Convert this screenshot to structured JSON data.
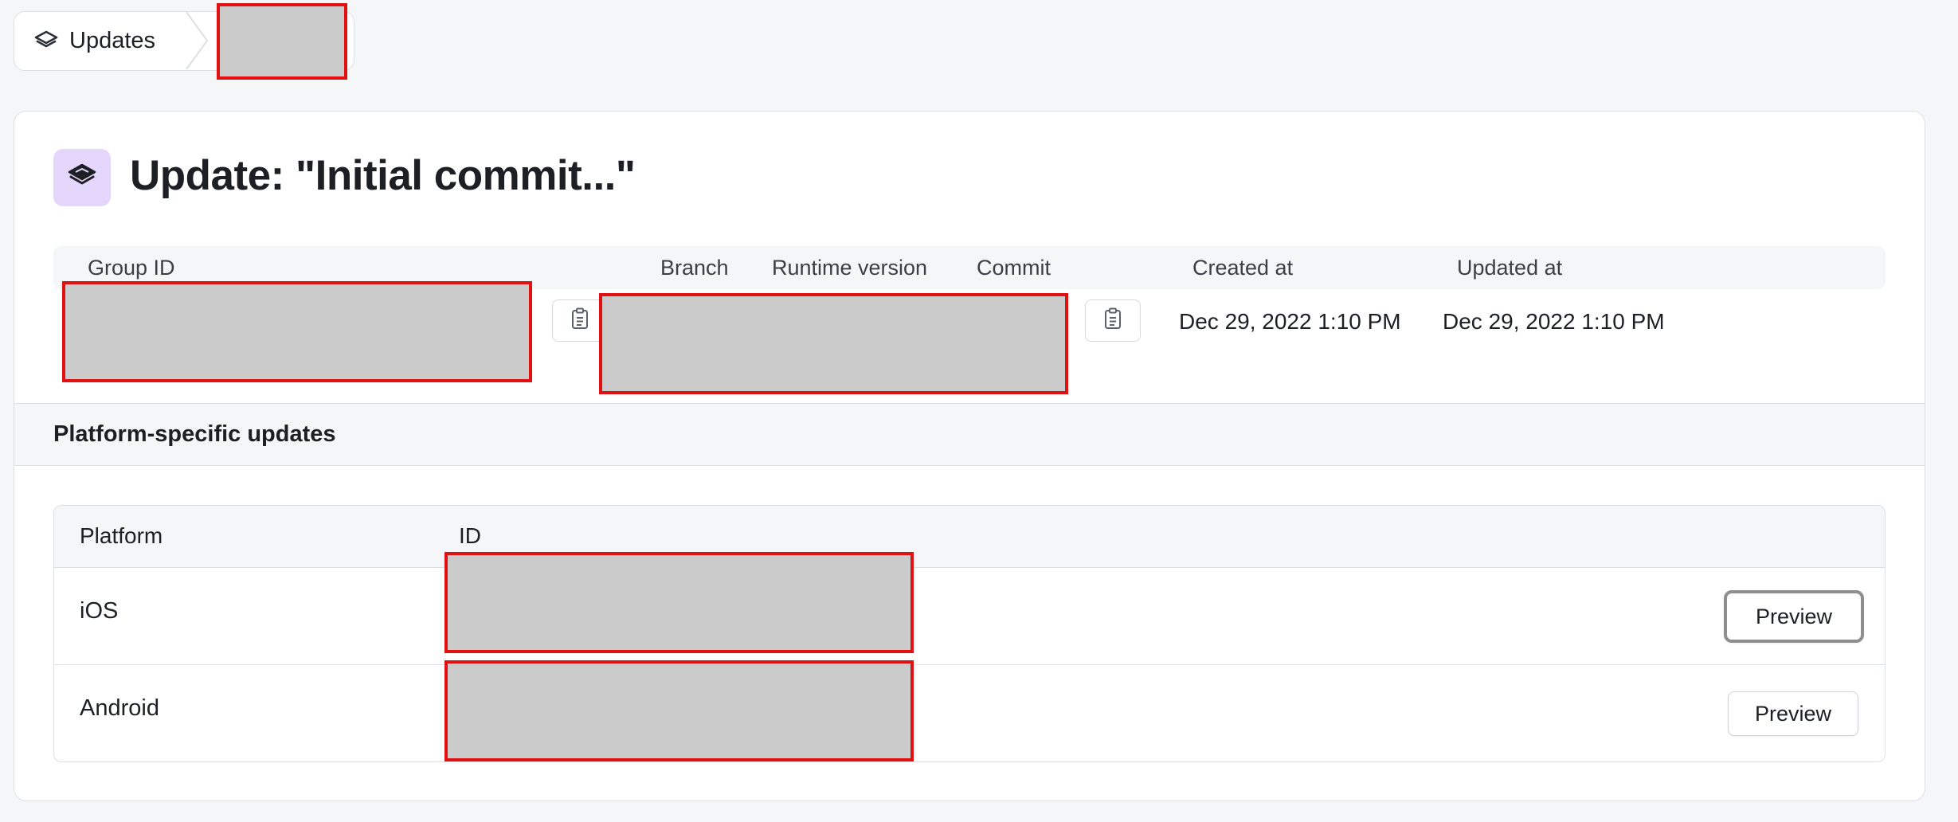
{
  "breadcrumb": {
    "updates_label": "Updates",
    "icon": "layers-icon"
  },
  "update": {
    "title": "Update: \"Initial commit...\"",
    "icon": "layers-icon",
    "icon_bg": "#e4d7fb"
  },
  "meta": {
    "headers": {
      "group_id": "Group ID",
      "branch": "Branch",
      "runtime_version": "Runtime version",
      "commit": "Commit",
      "created_at": "Created at",
      "updated_at": "Updated at"
    },
    "created_at": "Dec 29, 2022 1:10 PM",
    "updated_at": "Dec 29, 2022 1:10 PM"
  },
  "platform_section": {
    "title": "Platform-specific updates",
    "headers": {
      "platform": "Platform",
      "id": "ID"
    },
    "rows": [
      {
        "platform": "iOS",
        "action": "Preview"
      },
      {
        "platform": "Android",
        "action": "Preview"
      }
    ]
  },
  "colors": {
    "redaction_fill": "#cbcbcb",
    "redaction_border": "#e21111",
    "accent_purple": "#e4d7fb",
    "page_bg": "#f5f6f8"
  }
}
